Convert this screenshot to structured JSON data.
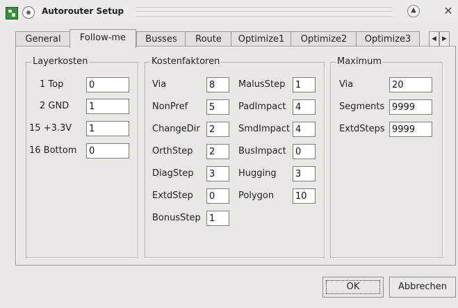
{
  "window": {
    "title": "Autorouter Setup"
  },
  "tabs": [
    "General",
    "Follow-me",
    "Busses",
    "Route",
    "Optimize1",
    "Optimize2",
    "Optimize3"
  ],
  "groups": {
    "layerkosten": {
      "title": "Layerkosten",
      "rows": [
        {
          "label": "1 Top",
          "value": "0"
        },
        {
          "label": "2 GND",
          "value": "1"
        },
        {
          "label": "15 +3.3V",
          "value": "1"
        },
        {
          "label": "16 Bottom",
          "value": "0"
        }
      ]
    },
    "kostenfaktoren": {
      "title": "Kostenfaktoren",
      "col1": [
        {
          "label": "Via",
          "value": "8"
        },
        {
          "label": "NonPref",
          "value": "5"
        },
        {
          "label": "ChangeDir",
          "value": "2"
        },
        {
          "label": "OrthStep",
          "value": "2"
        },
        {
          "label": "DiagStep",
          "value": "3"
        },
        {
          "label": "ExtdStep",
          "value": "0"
        },
        {
          "label": "BonusStep",
          "value": "1"
        }
      ],
      "col2": [
        {
          "label": "MalusStep",
          "value": "1"
        },
        {
          "label": "PadImpact",
          "value": "4"
        },
        {
          "label": "SmdImpact",
          "value": "4"
        },
        {
          "label": "BusImpact",
          "value": "0"
        },
        {
          "label": "Hugging",
          "value": "3"
        },
        {
          "label": "Polygon",
          "value": "10"
        }
      ]
    },
    "maximum": {
      "title": "Maximum",
      "rows": [
        {
          "label": "Via",
          "value": "20"
        },
        {
          "label": "Segments",
          "value": "9999"
        },
        {
          "label": "ExtdSteps",
          "value": "9999"
        }
      ]
    }
  },
  "buttons": {
    "ok": "OK",
    "cancel": "Abbrechen"
  }
}
